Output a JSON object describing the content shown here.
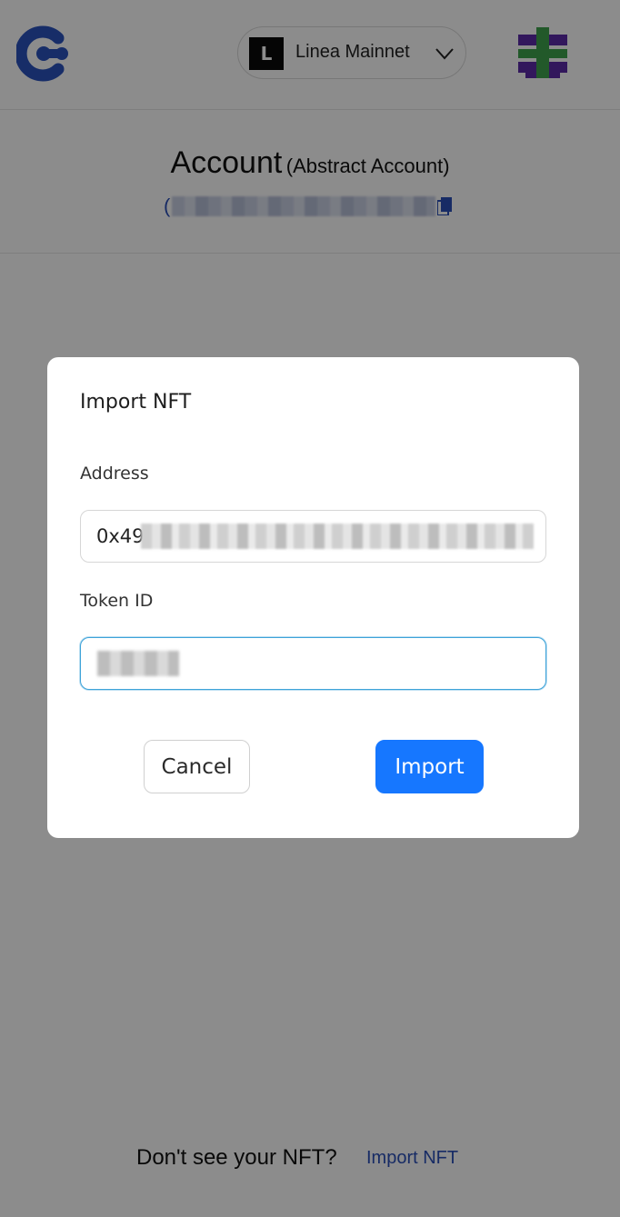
{
  "header": {
    "network": {
      "icon_letter": "L",
      "name": "Linea Mainnet"
    }
  },
  "account": {
    "title": "Account",
    "subtitle": "(Abstract Account)",
    "address_prefix": "("
  },
  "background": {
    "footer_question": "Don't see your NFT?",
    "footer_link": "Import NFT"
  },
  "modal": {
    "title": "Import NFT",
    "address_label": "Address",
    "address_value_visible": "0x49",
    "token_label": "Token ID",
    "cancel_label": "Cancel",
    "import_label": "Import"
  },
  "colors": {
    "primary": "#1677ff",
    "link": "#2a4fb8",
    "logo": "#2a52be"
  }
}
